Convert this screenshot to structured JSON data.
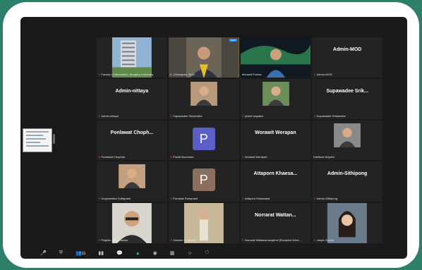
{
  "share": {
    "thumbnail_icon": "shared-screen-thumbnail"
  },
  "participants": [
    {
      "label": "Faculty of Informatics, Burapha University",
      "big": "",
      "kind": "building",
      "muted": true
    },
    {
      "label": "K. Chinnapan, BUU",
      "big": "",
      "kind": "man-yellow",
      "muted": false,
      "badge": "Host",
      "active": true
    },
    {
      "label": "Worawit Pontae",
      "big": "",
      "kind": "aurora",
      "muted": false
    },
    {
      "label": "Admin-MOD",
      "big": "Admin-MOD",
      "kind": "name",
      "muted": true
    },
    {
      "label": "Admin-nittaya",
      "big": "Admin-nittaya",
      "kind": "name",
      "muted": true
    },
    {
      "label": "Supawadee Srikamdee",
      "big": "",
      "kind": "small-photo-a",
      "muted": true
    },
    {
      "label": "pichet wayalun",
      "big": "",
      "kind": "small-photo-b",
      "muted": true
    },
    {
      "label": "Supawadee Srikamdee",
      "big": "Supawadee Srik...",
      "kind": "name",
      "muted": true
    },
    {
      "label": "Ponlawat Chophuk",
      "big": "Ponlawat Choph...",
      "kind": "name",
      "muted": true
    },
    {
      "label": "Prawit Boonmee",
      "big": "",
      "kind": "avatar-p-blue",
      "muted": true,
      "letter": "P"
    },
    {
      "label": "Worawit Werapan",
      "big": "Worawit Werapan",
      "kind": "name",
      "muted": true
    },
    {
      "label": "Kanitsat Veiyaen",
      "big": "",
      "kind": "small-photo-c",
      "muted": false
    },
    {
      "label": "Ungsumalee Suttapakti",
      "big": "",
      "kind": "small-photo-d",
      "muted": true
    },
    {
      "label": "Pornsiak Pamprasit",
      "big": "",
      "kind": "avatar-p-brown",
      "muted": true,
      "letter": "P"
    },
    {
      "label": "Attaporn Khaesakat",
      "big": "Attaporn Khaesa...",
      "kind": "name",
      "muted": true
    },
    {
      "label": "Admin-Sithipong",
      "big": "Admin-Sithipong",
      "kind": "name",
      "muted": true
    },
    {
      "label": "Prajaks Jitngernadan",
      "big": "",
      "kind": "man-glasses",
      "muted": true
    },
    {
      "label": "Unsiwer Kuatiyom",
      "big": "",
      "kind": "woman-wall",
      "muted": true
    },
    {
      "label": "Norrarat Wattanamongkhol (Burapha Unive...",
      "big": "Norrarat Wattan...",
      "kind": "name",
      "muted": true
    },
    {
      "label": "Janya Chpaio",
      "big": "",
      "kind": "woman-smile",
      "muted": true
    }
  ],
  "toolbar": {
    "participants_count": "21",
    "icons": [
      "mute-icon",
      "security-icon",
      "participants-icon",
      "polls-icon",
      "chat-icon",
      "share-icon",
      "record-icon",
      "breakout-icon",
      "reactions-icon",
      "leave-icon"
    ]
  }
}
